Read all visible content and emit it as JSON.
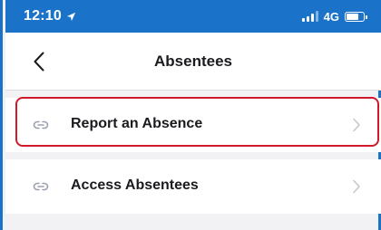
{
  "status_bar": {
    "time": "12:10",
    "network": "4G"
  },
  "nav": {
    "title": "Absentees",
    "back_icon": "chevron-left-icon"
  },
  "menu": {
    "items": [
      {
        "label": "Report an Absence",
        "icon": "link-icon",
        "highlighted": true
      },
      {
        "label": "Access Absentees",
        "icon": "link-icon",
        "highlighted": false
      }
    ]
  },
  "colors": {
    "status_bar": "#1a73c8",
    "highlight": "#d0192a",
    "background": "#f2f2f5"
  }
}
